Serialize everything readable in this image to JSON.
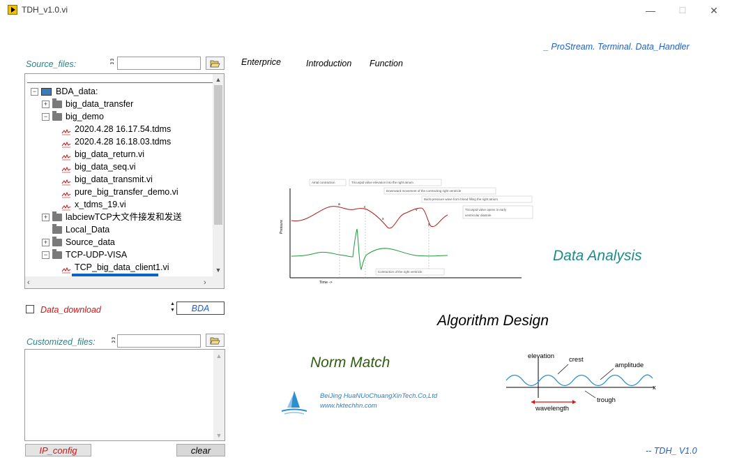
{
  "window": {
    "title": "TDH_v1.0.vi",
    "minimize": "—",
    "maximize": "☐",
    "close": "✕"
  },
  "header_brand": "_ ProStream. Terminal. Data_Handler",
  "menu": {
    "enterprise": "Enterprice",
    "introduction": "Introduction",
    "function": "Function"
  },
  "source": {
    "label": "Source_files:",
    "path_value": "",
    "tree": [
      {
        "label": "BDA_data:",
        "type": "root",
        "expander": "−"
      },
      {
        "label": "big_data_transfer",
        "type": "folder",
        "expander": "+"
      },
      {
        "label": "big_demo",
        "type": "folder",
        "expander": "−"
      },
      {
        "label": "2020.4.28 16.17.54.tdms",
        "type": "file"
      },
      {
        "label": "2020.4.28 16.18.03.tdms",
        "type": "file"
      },
      {
        "label": "big_data_return.vi",
        "type": "file"
      },
      {
        "label": "big_data_seq.vi",
        "type": "file"
      },
      {
        "label": "big_data_transmit.vi",
        "type": "file"
      },
      {
        "label": "pure_big_transfer_demo.vi",
        "type": "file"
      },
      {
        "label": "x_tdms_19.vi",
        "type": "file"
      },
      {
        "label": "labciewTCP大文件接发和发送",
        "type": "folder",
        "expander": "+"
      },
      {
        "label": "Local_Data",
        "type": "folder",
        "expander": ""
      },
      {
        "label": "Source_data",
        "type": "folder",
        "expander": "+"
      },
      {
        "label": "TCP-UDP-VISA",
        "type": "folder",
        "expander": "−"
      },
      {
        "label": "TCP_big_data_client1.vi",
        "type": "file"
      }
    ]
  },
  "download": {
    "label": "Data_download",
    "checked": false,
    "value": "BDA"
  },
  "customized": {
    "label": "Customized_files:",
    "path_value": "",
    "content": ""
  },
  "buttons": {
    "ip_config": "IP_config",
    "clear": "clear"
  },
  "heart_chart": {
    "y_axis": "Pressure",
    "x_axis": "Time ->",
    "annotations": [
      "Atrial contraction",
      "Tricuspid valve elevation into the right atrium",
      "Downward movement of the contracting right ventricle",
      "Back-pressure wave from blood filling the right atrium",
      "Tricuspid valve opens in early",
      "ventricular diastole",
      "Contraction of the right ventricle"
    ],
    "points": [
      "a",
      "c",
      "x",
      "v",
      "y"
    ]
  },
  "wave_diagram": {
    "elevation": "elevation",
    "crest": "crest",
    "amplitude": "amplitude",
    "trough": "trough",
    "wavelength": "wavelength",
    "x_axis": "x"
  },
  "labels": {
    "data_analysis": "Data Analysis",
    "algorithm_design": "Algorithm Design",
    "norm_match": "Norm Match"
  },
  "company": {
    "name": "BeiJing HuaNUoChuangXinTech.Co,Ltd",
    "url": "www.hktechhn.com"
  },
  "version": "-- TDH_ V1.0",
  "colors": {
    "teal": "#1f8a8a",
    "blue": "#1f5fc4",
    "red": "#e01010",
    "wave": "#2a8fd0"
  }
}
